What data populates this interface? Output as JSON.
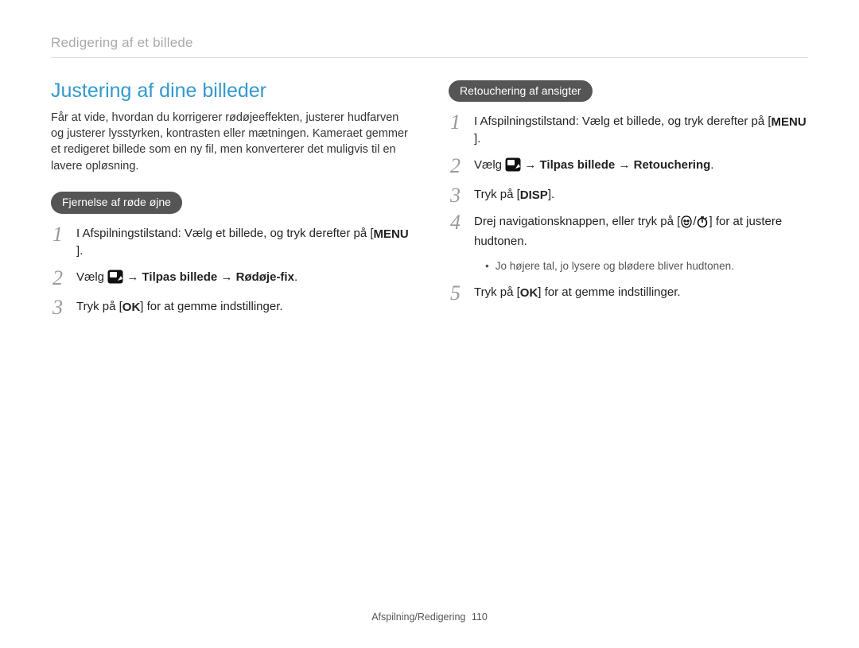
{
  "header": {
    "title": "Redigering af et billede"
  },
  "left": {
    "title": "Justering af dine billeder",
    "intro": "Får at vide, hvordan du korrigerer rødøjeeffekten, justerer hudfarven og justerer lysstyrken, kontrasten eller mætningen. Kameraet gemmer et redigeret billede som en ny fil, men konverterer det muligvis til en lavere opløsning.",
    "pill": "Fjernelse af røde øjne",
    "steps": {
      "s1_a": "I Afspilningstilstand: Vælg et billede, og tryk derefter på [",
      "s1_b": "].",
      "menu_label": "MENU",
      "s2_a": "Vælg ",
      "s2_b": " → Tilpas billede → Rødøje-fix",
      "s2_c": ".",
      "s3_a": "Tryk på [",
      "s3_b": "] for at gemme indstillinger.",
      "ok_label": "OK"
    }
  },
  "right": {
    "pill": "Retouchering af ansigter",
    "steps": {
      "s1_a": "I Afspilningstilstand: Vælg et billede, og tryk derefter på [",
      "s1_b": "].",
      "menu_label": "MENU",
      "s2_a": "Vælg ",
      "s2_b": " → Tilpas billede → Retouchering",
      "s2_c": ".",
      "s3_a": "Tryk på [",
      "s3_b": "].",
      "disp_label": "DISP",
      "s4_a": "Drej navigationsknappen, eller tryk på [",
      "s4_sep": "/",
      "s4_b": "] for at justere hudtonen.",
      "note1": "Jo højere tal, jo lysere og blødere bliver hudtonen.",
      "s5_a": "Tryk på [",
      "s5_b": "] for at gemme indstillinger.",
      "ok_label": "OK"
    }
  },
  "icons": {
    "edit": "edit-photo-icon",
    "face": "face-icon",
    "timer": "timer-icon"
  },
  "footer": {
    "section": "Afspilning/Redigering",
    "page": "110"
  }
}
